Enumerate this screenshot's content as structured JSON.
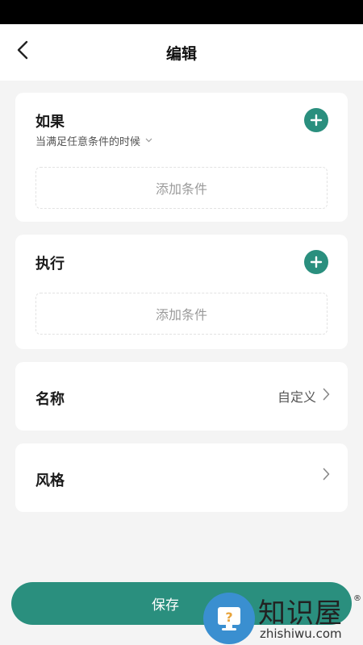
{
  "header": {
    "title": "编辑",
    "back_icon": "chevron-left-icon"
  },
  "if_card": {
    "title": "如果",
    "condition_mode": "当满足任意条件的时候",
    "add_label": "添加条件",
    "add_icon": "plus-circle-icon"
  },
  "then_card": {
    "title": "执行",
    "add_label": "添加条件",
    "add_icon": "plus-circle-icon"
  },
  "name_row": {
    "label": "名称",
    "value": "自定义"
  },
  "style_row": {
    "label": "风格"
  },
  "footer": {
    "save_label": "保存"
  },
  "watermark": {
    "text": "知识屋",
    "reg": "®",
    "url": "zhishiwu.com"
  },
  "colors": {
    "accent": "#2a8f7e",
    "background": "#f4f4f4",
    "card": "#ffffff"
  }
}
